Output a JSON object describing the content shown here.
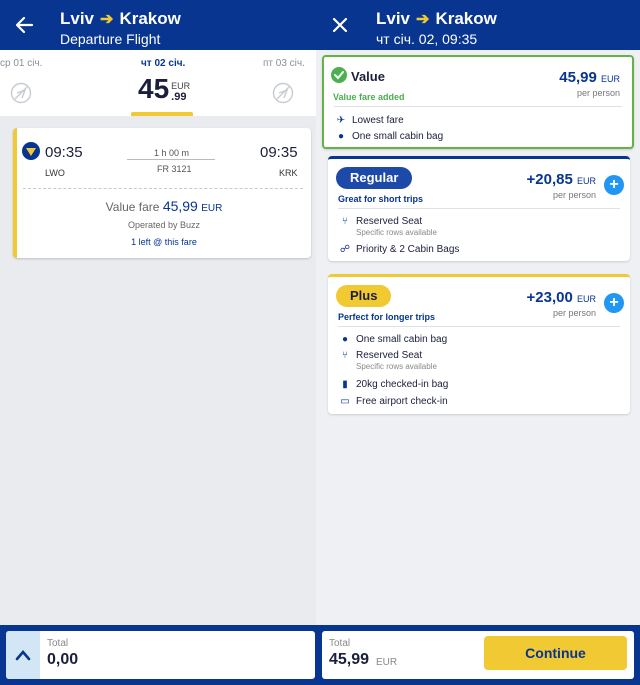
{
  "left": {
    "header": {
      "from": "Lviv",
      "to": "Krakow",
      "subtitle": "Departure Flight"
    },
    "dates": {
      "prev": "ср 01 січ.",
      "selected": "чт 02 січ.",
      "next": "пт 03 січ.",
      "price_int": "45",
      "price_dec": ".99",
      "currency": "EUR"
    },
    "flight": {
      "dep_time": "09:35",
      "arr_time": "09:35",
      "dep_airport": "LWO",
      "arr_airport": "KRK",
      "duration": "1 h 00 m",
      "flight_no": "FR 3121",
      "fare_label": "Value fare",
      "fare_amount": "45,99",
      "fare_currency": "EUR",
      "operated": "Operated by Buzz",
      "seats_left": "1 left @ this fare"
    },
    "bottom": {
      "total_label": "Total",
      "total_value": "0,00"
    }
  },
  "right": {
    "header": {
      "from": "Lviv",
      "to": "Krakow",
      "subtitle": "чт січ. 02, 09:35"
    },
    "value": {
      "title": "Value",
      "added": "Value fare added",
      "price": "45,99",
      "currency": "EUR",
      "per": "per person",
      "features": [
        "Lowest fare",
        "One small cabin bag"
      ]
    },
    "regular": {
      "title": "Regular",
      "tag": "Great for short trips",
      "price": "+20,85",
      "currency": "EUR",
      "per": "per person",
      "f1": "Reserved Seat",
      "f1_sub": "Specific rows available",
      "f2": "Priority & 2 Cabin Bags"
    },
    "plus": {
      "title": "Plus",
      "tag": "Perfect for longer trips",
      "price": "+23,00",
      "currency": "EUR",
      "per": "per person",
      "f1": "One small cabin bag",
      "f2": "Reserved Seat",
      "f2_sub": "Specific rows available",
      "f3": "20kg checked-in bag",
      "f4": "Free airport check-in"
    },
    "bottom": {
      "total_label": "Total",
      "total_value": "45,99",
      "currency": "EUR",
      "continue": "Continue"
    }
  },
  "colors": {
    "brand": "#073590",
    "accent": "#f1c933",
    "success": "#4caf50",
    "add": "#2196f3"
  }
}
